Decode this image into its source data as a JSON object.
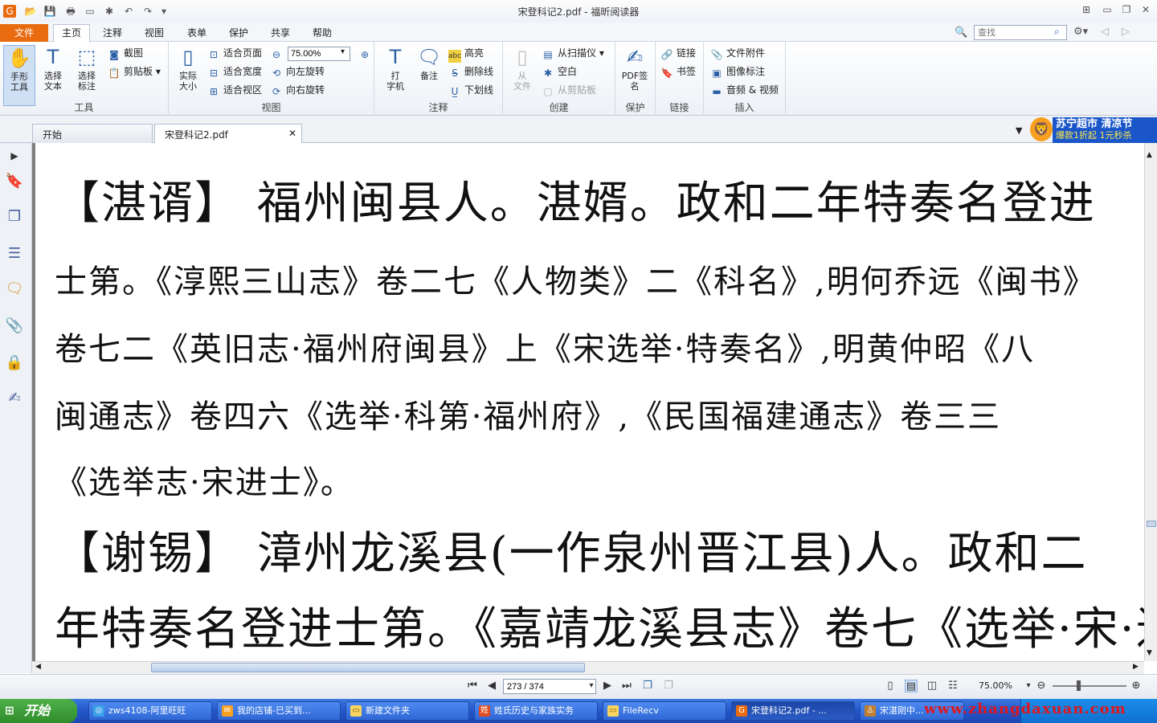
{
  "window": {
    "title": "宋登科记2.pdf - 福昕阅读器"
  },
  "menu": {
    "file": "文件",
    "items": [
      "主页",
      "注释",
      "视图",
      "表单",
      "保护",
      "共享",
      "帮助"
    ]
  },
  "search": {
    "placeholder": "查找"
  },
  "ribbon": {
    "tools": {
      "label": "工具",
      "hand": "手形\n工具",
      "select_text": "选择\n文本",
      "select_annot": "选择\n标注",
      "snapshot": "截图",
      "clipboard": "剪贴板"
    },
    "view": {
      "label": "视图",
      "actual": "实际\n大小",
      "fit_page": "适合页面",
      "fit_width": "适合宽度",
      "fit_visible": "适合视区",
      "zoom": "75.00%",
      "rotate_left": "向左旋转",
      "rotate_right": "向右旋转"
    },
    "annot": {
      "label": "注释",
      "typewriter": "打\n字机",
      "note": "备注",
      "highlight": "高亮",
      "strikeout": "删除线",
      "underline": "下划线"
    },
    "create": {
      "label": "创建",
      "from_file": "从\n文件",
      "from_scanner": "从扫描仪",
      "blank": "空白",
      "from_clipboard": "从剪贴板"
    },
    "protect": {
      "label": "保护",
      "pdf_sign": "PDF签\n名"
    },
    "links": {
      "label": "链接",
      "link": "链接",
      "bookmark": "书签"
    },
    "insert": {
      "label": "插入",
      "attachment": "文件附件",
      "image": "图像标注",
      "media": "音频 & 视频"
    }
  },
  "tabs": [
    {
      "label": "开始"
    },
    {
      "label": "宋登科记2.pdf"
    }
  ],
  "ad": {
    "line1": "苏宁超市 清凉节",
    "line2": "爆款1折起 1元秒杀"
  },
  "document": {
    "lines": [
      {
        "text": "【湛谞】  福州闽县人。湛婿。政和二年特奏名登进",
        "size": "big"
      },
      {
        "text": "士第。《淳熙三山志》卷二七《人物类》二《科名》,明何乔远《闽书》",
        "size": "sm"
      },
      {
        "text": "卷七二《英旧志·福州府闽县》上《宋选举·特奏名》,明黄仲昭《八",
        "size": "sm"
      },
      {
        "text": "闽通志》卷四六《选举·科第·福州府》,《民国福建通志》卷三三",
        "size": "sm"
      },
      {
        "text": "《选举志·宋进士》。",
        "size": "sm"
      },
      {
        "text": "【谢锡】  漳州龙溪县(一作泉州晋江县)人。政和二",
        "size": "big"
      },
      {
        "text": "年特奏名登进士第。《嘉靖龙溪县志》卷七《选举·宋·进",
        "size": "big"
      }
    ]
  },
  "status": {
    "page": "273 / 374",
    "zoom": "75.00%"
  },
  "taskbar": {
    "start": "开始",
    "items": [
      {
        "label": "zws4108-阿里旺旺",
        "color": "#ffffff"
      },
      {
        "label": "我的店铺-已买到...",
        "color": "#f7a020"
      },
      {
        "label": "新建文件夹",
        "color": "#f7d560"
      },
      {
        "label": "姓氏历史与家族实务",
        "color": "#e04a20"
      },
      {
        "label": "FileRecv",
        "color": "#f7d560"
      },
      {
        "label": "宋登科记2.pdf - ...",
        "color": "#e96b10"
      },
      {
        "label": "宋湛刚中...",
        "color": "#c08030"
      }
    ]
  },
  "watermark": "www.zhangdaxuan.com"
}
